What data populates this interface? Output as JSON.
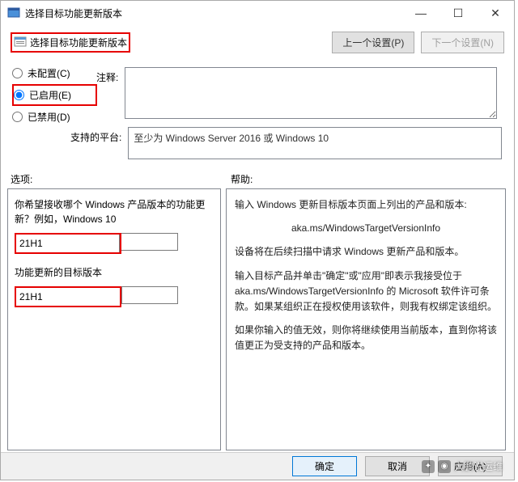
{
  "window": {
    "title": "选择目标功能更新版本"
  },
  "topbar": {
    "title": "选择目标功能更新版本",
    "prev_btn": "上一个设置(P)",
    "next_btn": "下一个设置(N)"
  },
  "radios": {
    "not_configured": "未配置(C)",
    "enabled": "已启用(E)",
    "disabled": "已禁用(D)",
    "selected": "enabled"
  },
  "comment": {
    "label": "注释:",
    "value": ""
  },
  "platform": {
    "label": "支持的平台:",
    "value": "至少为 Windows Server 2016 或 Windows 10"
  },
  "sections": {
    "options": "选项:",
    "help": "帮助:"
  },
  "options": {
    "product_question": "你希望接收哪个 Windows 产品版本的功能更新？例如，Windows 10",
    "product_value": "21H1",
    "target_label": "功能更新的目标版本",
    "target_value": "21H1"
  },
  "help": {
    "p1": "输入 Windows 更新目标版本页面上列出的产品和版本:",
    "link": "aka.ms/WindowsTargetVersionInfo",
    "p2": "设备将在后续扫描中请求 Windows 更新产品和版本。",
    "p3": "输入目标产品并单击\"确定\"或\"应用\"即表示我接受位于 aka.ms/WindowsTargetVersionInfo 的 Microsoft 软件许可条款。如果某组织正在授权使用该软件，则我有权绑定该组织。",
    "p4": "如果你输入的值无效，则你将继续使用当前版本，直到你将该值更正为受支持的产品和版本。"
  },
  "footer": {
    "ok": "确定",
    "cancel": "取消",
    "apply": "应用(A)"
  },
  "watermark": "大鹏说运维"
}
